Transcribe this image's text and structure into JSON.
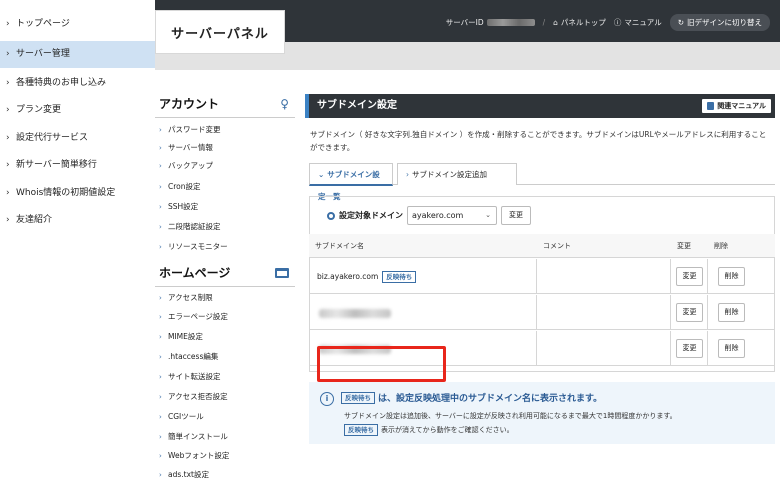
{
  "outer_menu": {
    "items": [
      {
        "label": "トップページ",
        "active": false
      },
      {
        "label": "サーバー管理",
        "active": true
      },
      {
        "label": "各種特典のお申し込み",
        "active": false
      },
      {
        "label": "プラン変更",
        "active": false
      },
      {
        "label": "設定代行サービス",
        "active": false
      },
      {
        "label": "新サーバー簡単移行",
        "active": false
      },
      {
        "label": "Whois情報の初期値設定",
        "active": false
      },
      {
        "label": "友達紹介",
        "active": false
      }
    ]
  },
  "header": {
    "logo": "サーバーパネル",
    "server_id_label": "サーバーID",
    "panel_top": "パネルトップ",
    "manual": "マニュアル",
    "old_design": "旧デザインに切り替え"
  },
  "sidebar": {
    "account_title": "アカウント",
    "account_items": [
      "パスワード変更",
      "サーバー情報",
      "バックアップ",
      "Cron設定",
      "SSH設定",
      "二段階認証設定",
      "リソースモニター"
    ],
    "homepage_title": "ホームページ",
    "homepage_items": [
      "アクセス制限",
      "エラーページ設定",
      "MIME設定",
      ".htaccess編集",
      "サイト転送設定",
      "アクセス拒否設定",
      "CGIツール",
      "簡単インストール",
      "Webフォント設定",
      "ads.txt設定"
    ]
  },
  "main": {
    "title": "サブドメイン設定",
    "manual_button": "関連マニュアル",
    "description": "サブドメイン（ 好きな文字列.独自ドメイン ）を作成・削除することができます。サブドメインはURLやメールアドレスに利用することができます。",
    "tabs": [
      {
        "label": "サブドメイン設定一覧",
        "active": true
      },
      {
        "label": "サブドメイン設定追加",
        "active": false
      }
    ],
    "target_domain_label": "設定対象ドメイン",
    "target_domain_value": "ayakero.com",
    "domain_change_button": "変更",
    "table": {
      "headers": {
        "subdomain": "サブドメイン名",
        "comment": "コメント",
        "change": "変更",
        "delete": "削除"
      },
      "rows": [
        {
          "subdomain": "biz.ayakero.com",
          "badge": "反映待ち",
          "change": "変更",
          "delete": "削除"
        },
        {
          "subdomain": "",
          "badge": "",
          "change": "変更",
          "delete": "削除"
        },
        {
          "subdomain": "",
          "badge": "",
          "change": "変更",
          "delete": "削除"
        }
      ]
    },
    "info": {
      "badge": "反映待ち",
      "title": "は、設定反映処理中のサブドメイン名に表示されます。",
      "line1": "サブドメイン設定は追加後、サーバーに設定が反映され利用可能になるまで最大で1時間程度かかります。",
      "line2_badge": "反映待ち",
      "line2": "表示が消えてから動作をご確認ください。"
    }
  }
}
